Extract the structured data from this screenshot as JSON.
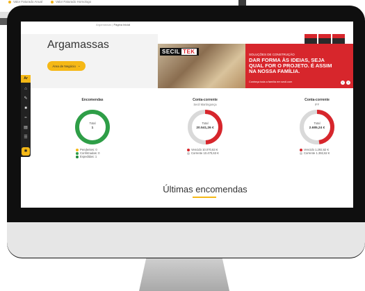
{
  "legend_top": [
    "Valor Faturado Anual",
    "Valor Faturado Homologo"
  ],
  "breadcrumb": {
    "root": "Argamassas",
    "current": "Página Inicial"
  },
  "page": {
    "title": "Argamassas",
    "area_button": "Área de Negócio",
    "area_chevron": "⌄"
  },
  "banner": {
    "brand": "SECIL",
    "brand_accent": "TEK",
    "kicker": "SOLUÇÕES DE CONSTRUÇÃO",
    "headline": "DAR FORMA ÀS IDEIAS, SEJA QUAL FOR O PROJETO. É ASSIM NA NOSSA FAMÍLIA.",
    "cta": "Conheça toda a família em secil.com",
    "prev": "‹",
    "next": "›",
    "colors": {
      "accent": "#d7262c"
    }
  },
  "sidebar": {
    "top": "Ar",
    "icons": [
      "home-icon",
      "edit-icon",
      "box-icon",
      "chart-icon",
      "document-icon",
      "list-icon"
    ],
    "bottom_icon": "gear-icon"
  },
  "cards": [
    {
      "title": "Encomendas",
      "subtitle": "",
      "donut_label": "Total",
      "donut_value": "1",
      "chart_data": {
        "type": "pie",
        "values": [
          0,
          0,
          1
        ],
        "labels": [
          "Pendentes",
          "Confirmadas",
          "Expedidas"
        ],
        "colors": [
          "#f5b816",
          "#2e9e47",
          "#1f8a3a"
        ]
      },
      "legend": [
        "Pendentes: 0",
        "Confirmadas: 0",
        "Expedidas: 1"
      ],
      "legend_colors": [
        "#f5b816",
        "#2e9e47",
        "#1f8a3a"
      ]
    },
    {
      "title": "Conta-corrente",
      "subtitle": "Secil Martingança",
      "donut_label": "Total",
      "donut_value": "20.541,26 €",
      "chart_data": {
        "type": "pie",
        "values": [
          10070.63,
          10470.63
        ],
        "labels": [
          "Vencido",
          "Corrente"
        ],
        "colors": [
          "#d7262c",
          "#d9d9d9"
        ]
      },
      "legend": [
        "Vencido 10.070,63 €",
        "Corrente 10.470,63 €"
      ],
      "legend_colors": [
        "#d7262c",
        "#cccccc"
      ]
    },
    {
      "title": "Conta-corrente",
      "subtitle": "IFF",
      "donut_label": "Total",
      "donut_value": "2.685,24 €",
      "chart_data": {
        "type": "pie",
        "values": [
          1292.62,
          1392.62
        ],
        "labels": [
          "Vencido",
          "Corrente"
        ],
        "colors": [
          "#d7262c",
          "#d9d9d9"
        ]
      },
      "legend": [
        "Vencido 1.292,62 €",
        "Corrente 1.392,62 €"
      ],
      "legend_colors": [
        "#d7262c",
        "#cccccc"
      ]
    }
  ],
  "section": {
    "title": "Últimas encomendas"
  }
}
